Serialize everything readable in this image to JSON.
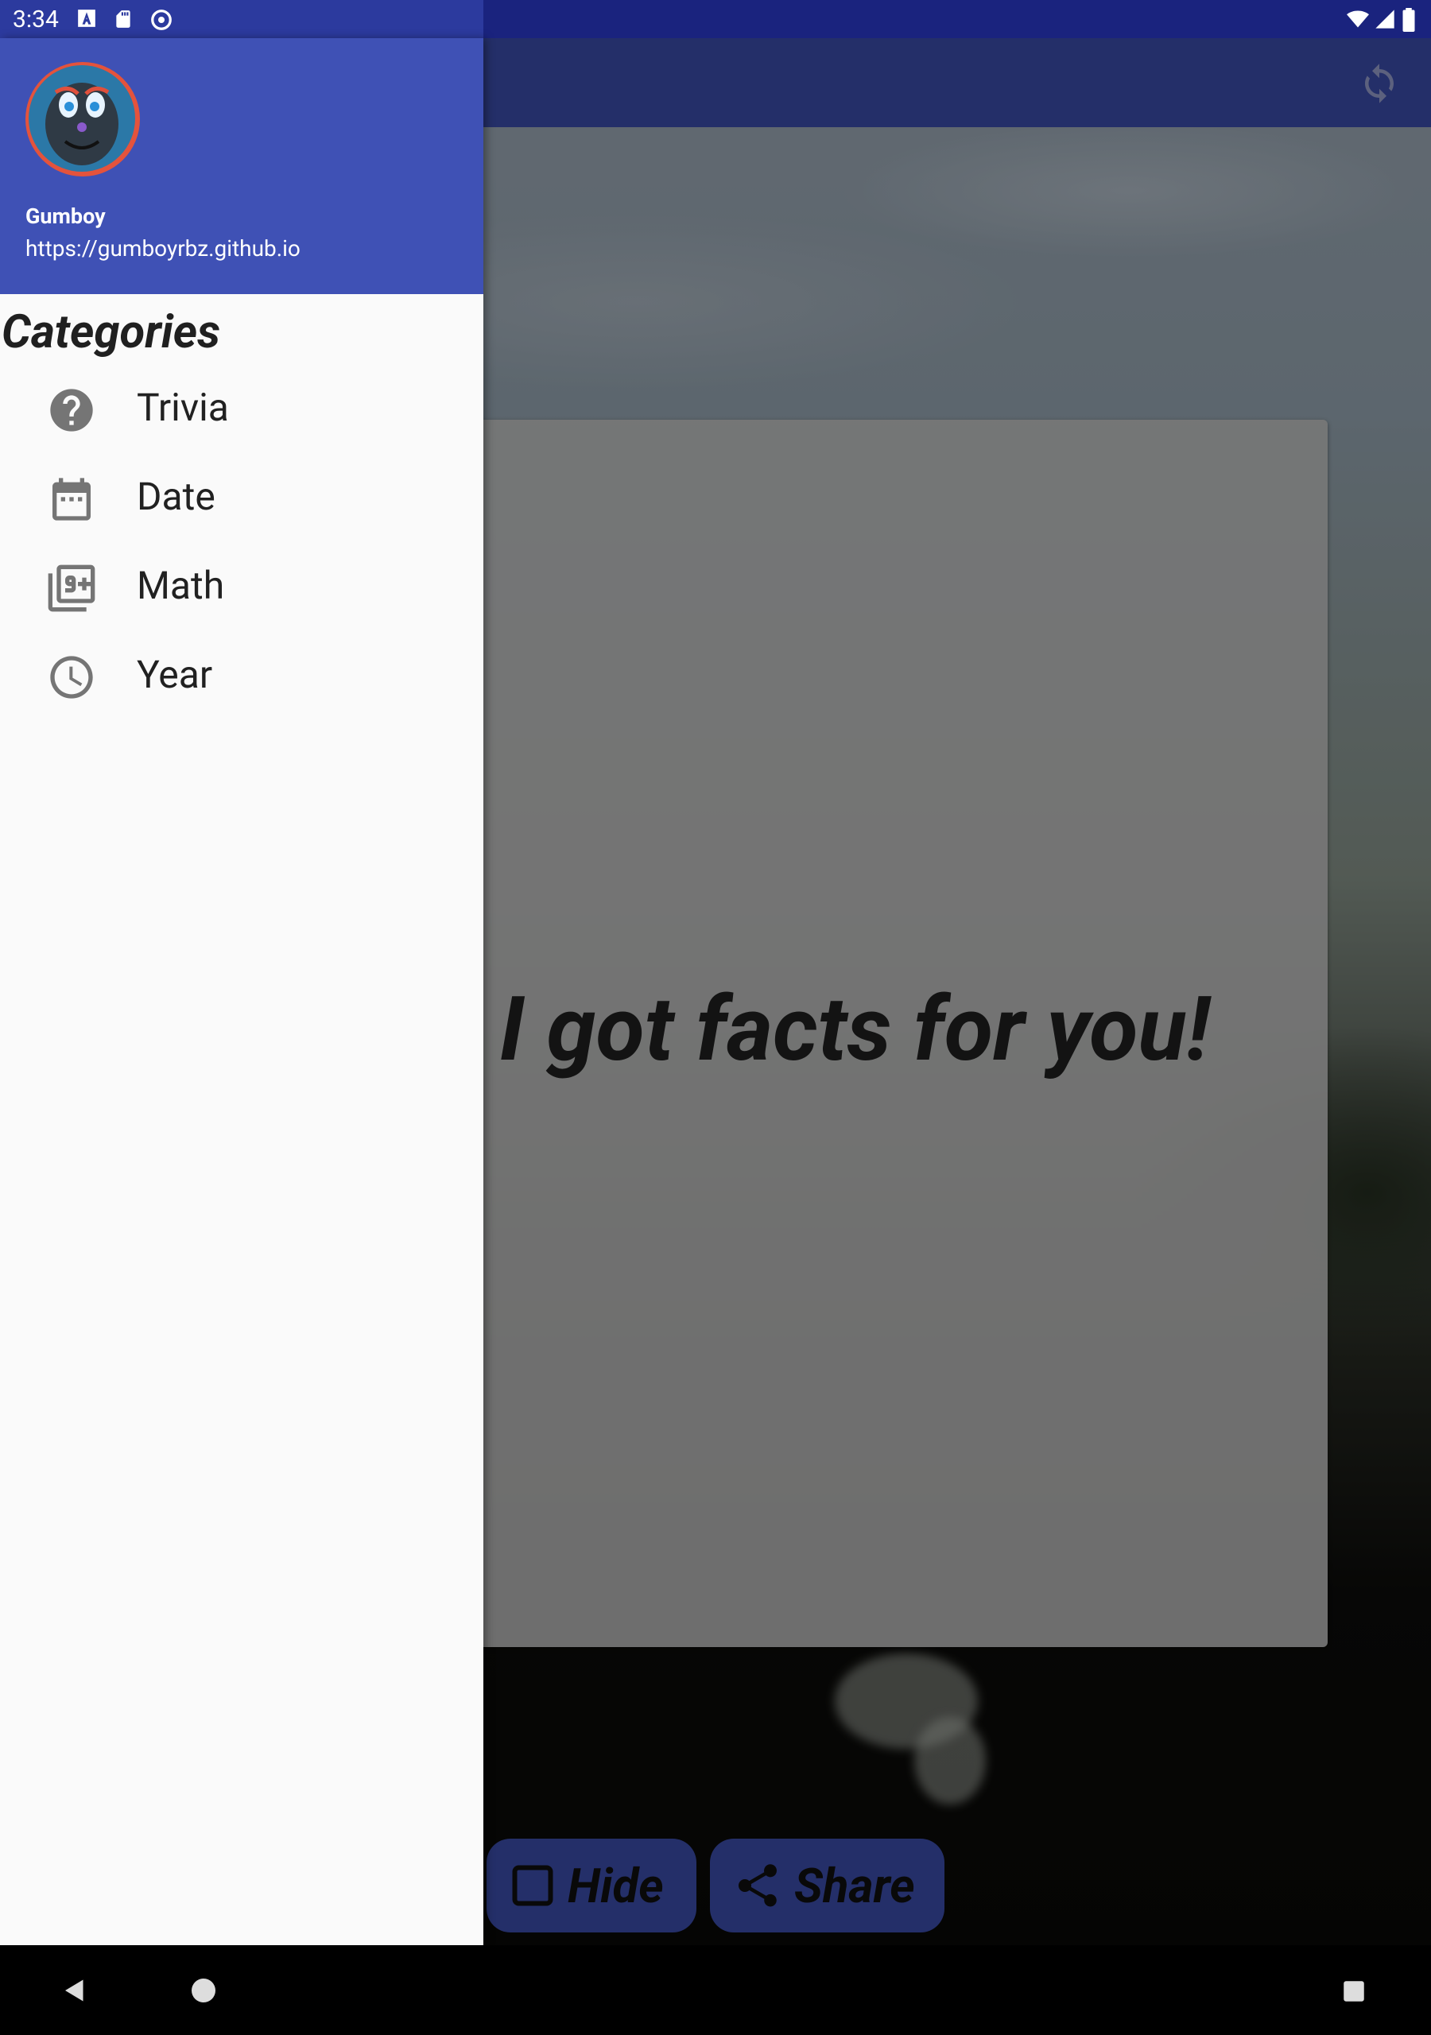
{
  "status_bar": {
    "time": "3:34"
  },
  "app": {
    "fact_text": "I got facts for you!",
    "hide_label": "Hide",
    "share_label": "Share"
  },
  "drawer": {
    "header": {
      "name": "Gumboy",
      "url": "https://gumboyrbz.github.io"
    },
    "section_title": "Categories",
    "items": [
      {
        "label": "Trivia",
        "icon": "help-circle-icon"
      },
      {
        "label": "Date",
        "icon": "calendar-icon"
      },
      {
        "label": "Math",
        "icon": "filter-9-plus-icon"
      },
      {
        "label": "Year",
        "icon": "clock-icon"
      }
    ]
  },
  "colors": {
    "primary": "#3f51b5",
    "primary_dark": "#1a237e",
    "drawer_bg": "#fafafa"
  }
}
